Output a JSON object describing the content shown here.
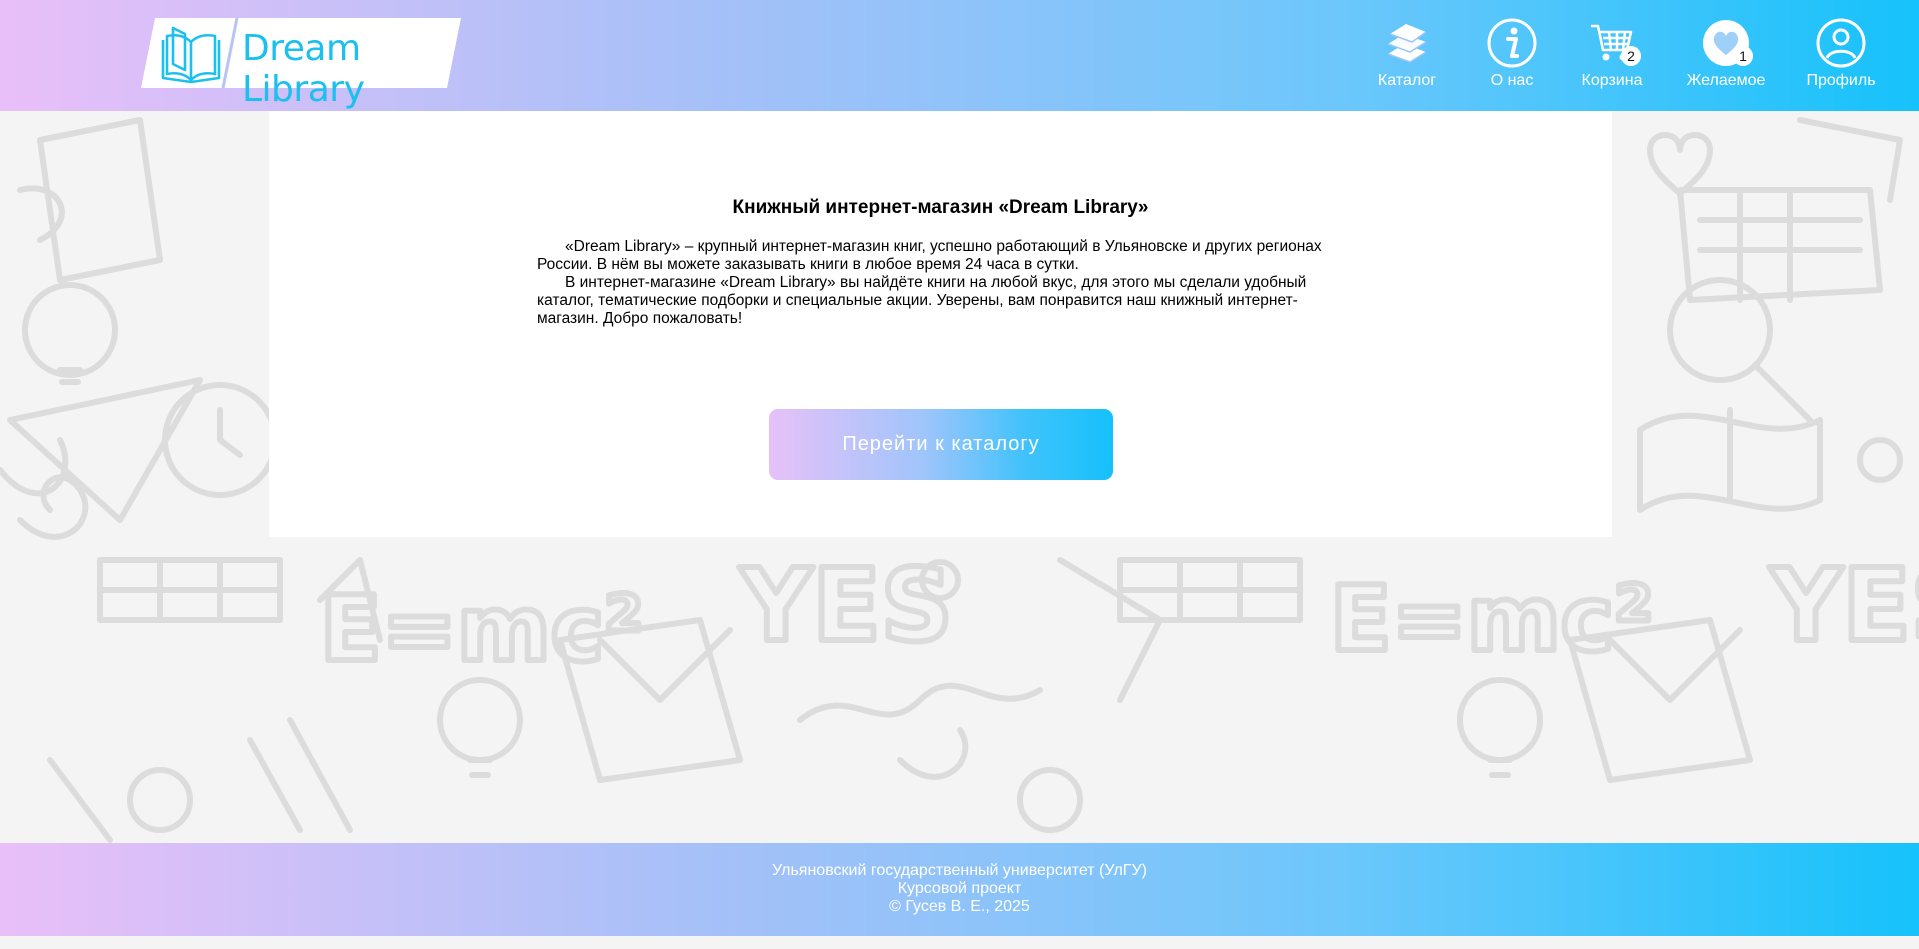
{
  "header": {
    "logo_text": "Dream Library",
    "nav": [
      {
        "label": "Каталог",
        "icon": "books-icon"
      },
      {
        "label": "О нас",
        "icon": "info-icon"
      },
      {
        "label": "Корзина",
        "icon": "cart-icon",
        "badge": "2"
      },
      {
        "label": "Желаемое",
        "icon": "heart-icon",
        "badge": "1"
      },
      {
        "label": "Профиль",
        "icon": "user-icon"
      }
    ]
  },
  "main": {
    "title": "Книжный интернет-магазин «Dream Library»",
    "paragraphs": [
      "«Dream Library» – крупный интернет-магазин книг, успешно работающий в Ульяновске и других регионах России. В нём вы можете заказывать книги в любое время 24 часа в сутки.",
      "В интернет-магазине «Dream Library» вы найдёте книги на любой вкус, для этого мы сделали удобный каталог, тематические подборки и специальные акции. Уверены, вам понравится наш книжный интернет-магазин. Добро пожаловать!"
    ],
    "cta_label": "Перейти к каталогу"
  },
  "footer": {
    "lines": [
      "Ульяновский государственный университет (УлГУ)",
      "Курсовой проект",
      "© Гусев В. Е., 2025"
    ]
  },
  "colors": {
    "gradient_start": "#e9bff8",
    "gradient_end": "#16c2fb",
    "logo_accent": "#1cc0ee"
  }
}
